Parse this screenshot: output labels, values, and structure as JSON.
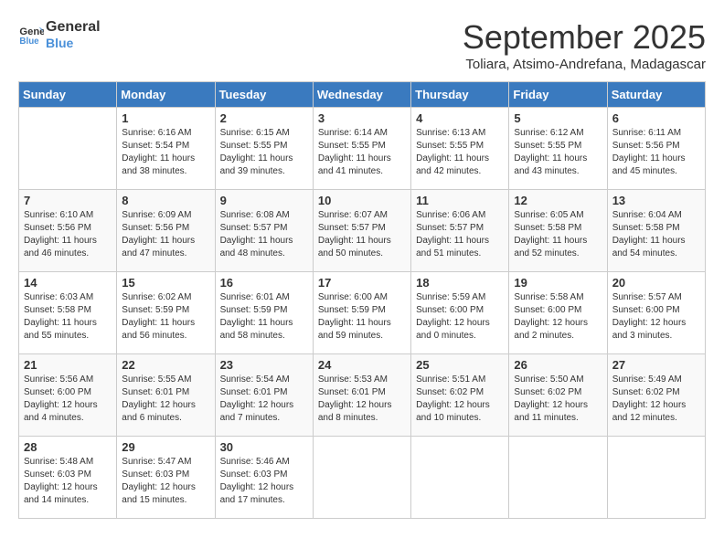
{
  "header": {
    "logo_line1": "General",
    "logo_line2": "Blue",
    "month": "September 2025",
    "location": "Toliara, Atsimo-Andrefana, Madagascar"
  },
  "weekdays": [
    "Sunday",
    "Monday",
    "Tuesday",
    "Wednesday",
    "Thursday",
    "Friday",
    "Saturday"
  ],
  "weeks": [
    [
      {
        "day": "",
        "info": ""
      },
      {
        "day": "1",
        "info": "Sunrise: 6:16 AM\nSunset: 5:54 PM\nDaylight: 11 hours\nand 38 minutes."
      },
      {
        "day": "2",
        "info": "Sunrise: 6:15 AM\nSunset: 5:55 PM\nDaylight: 11 hours\nand 39 minutes."
      },
      {
        "day": "3",
        "info": "Sunrise: 6:14 AM\nSunset: 5:55 PM\nDaylight: 11 hours\nand 41 minutes."
      },
      {
        "day": "4",
        "info": "Sunrise: 6:13 AM\nSunset: 5:55 PM\nDaylight: 11 hours\nand 42 minutes."
      },
      {
        "day": "5",
        "info": "Sunrise: 6:12 AM\nSunset: 5:55 PM\nDaylight: 11 hours\nand 43 minutes."
      },
      {
        "day": "6",
        "info": "Sunrise: 6:11 AM\nSunset: 5:56 PM\nDaylight: 11 hours\nand 45 minutes."
      }
    ],
    [
      {
        "day": "7",
        "info": "Sunrise: 6:10 AM\nSunset: 5:56 PM\nDaylight: 11 hours\nand 46 minutes."
      },
      {
        "day": "8",
        "info": "Sunrise: 6:09 AM\nSunset: 5:56 PM\nDaylight: 11 hours\nand 47 minutes."
      },
      {
        "day": "9",
        "info": "Sunrise: 6:08 AM\nSunset: 5:57 PM\nDaylight: 11 hours\nand 48 minutes."
      },
      {
        "day": "10",
        "info": "Sunrise: 6:07 AM\nSunset: 5:57 PM\nDaylight: 11 hours\nand 50 minutes."
      },
      {
        "day": "11",
        "info": "Sunrise: 6:06 AM\nSunset: 5:57 PM\nDaylight: 11 hours\nand 51 minutes."
      },
      {
        "day": "12",
        "info": "Sunrise: 6:05 AM\nSunset: 5:58 PM\nDaylight: 11 hours\nand 52 minutes."
      },
      {
        "day": "13",
        "info": "Sunrise: 6:04 AM\nSunset: 5:58 PM\nDaylight: 11 hours\nand 54 minutes."
      }
    ],
    [
      {
        "day": "14",
        "info": "Sunrise: 6:03 AM\nSunset: 5:58 PM\nDaylight: 11 hours\nand 55 minutes."
      },
      {
        "day": "15",
        "info": "Sunrise: 6:02 AM\nSunset: 5:59 PM\nDaylight: 11 hours\nand 56 minutes."
      },
      {
        "day": "16",
        "info": "Sunrise: 6:01 AM\nSunset: 5:59 PM\nDaylight: 11 hours\nand 58 minutes."
      },
      {
        "day": "17",
        "info": "Sunrise: 6:00 AM\nSunset: 5:59 PM\nDaylight: 11 hours\nand 59 minutes."
      },
      {
        "day": "18",
        "info": "Sunrise: 5:59 AM\nSunset: 6:00 PM\nDaylight: 12 hours\nand 0 minutes."
      },
      {
        "day": "19",
        "info": "Sunrise: 5:58 AM\nSunset: 6:00 PM\nDaylight: 12 hours\nand 2 minutes."
      },
      {
        "day": "20",
        "info": "Sunrise: 5:57 AM\nSunset: 6:00 PM\nDaylight: 12 hours\nand 3 minutes."
      }
    ],
    [
      {
        "day": "21",
        "info": "Sunrise: 5:56 AM\nSunset: 6:00 PM\nDaylight: 12 hours\nand 4 minutes."
      },
      {
        "day": "22",
        "info": "Sunrise: 5:55 AM\nSunset: 6:01 PM\nDaylight: 12 hours\nand 6 minutes."
      },
      {
        "day": "23",
        "info": "Sunrise: 5:54 AM\nSunset: 6:01 PM\nDaylight: 12 hours\nand 7 minutes."
      },
      {
        "day": "24",
        "info": "Sunrise: 5:53 AM\nSunset: 6:01 PM\nDaylight: 12 hours\nand 8 minutes."
      },
      {
        "day": "25",
        "info": "Sunrise: 5:51 AM\nSunset: 6:02 PM\nDaylight: 12 hours\nand 10 minutes."
      },
      {
        "day": "26",
        "info": "Sunrise: 5:50 AM\nSunset: 6:02 PM\nDaylight: 12 hours\nand 11 minutes."
      },
      {
        "day": "27",
        "info": "Sunrise: 5:49 AM\nSunset: 6:02 PM\nDaylight: 12 hours\nand 12 minutes."
      }
    ],
    [
      {
        "day": "28",
        "info": "Sunrise: 5:48 AM\nSunset: 6:03 PM\nDaylight: 12 hours\nand 14 minutes."
      },
      {
        "day": "29",
        "info": "Sunrise: 5:47 AM\nSunset: 6:03 PM\nDaylight: 12 hours\nand 15 minutes."
      },
      {
        "day": "30",
        "info": "Sunrise: 5:46 AM\nSunset: 6:03 PM\nDaylight: 12 hours\nand 17 minutes."
      },
      {
        "day": "",
        "info": ""
      },
      {
        "day": "",
        "info": ""
      },
      {
        "day": "",
        "info": ""
      },
      {
        "day": "",
        "info": ""
      }
    ]
  ]
}
